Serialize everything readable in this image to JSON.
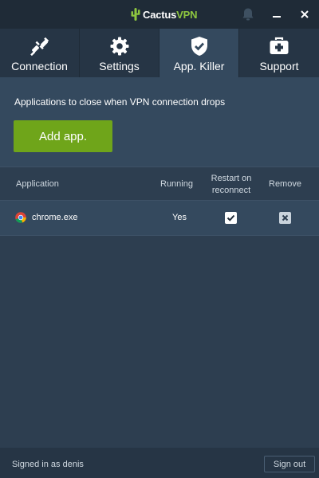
{
  "window": {
    "logo_part1": "Cactus",
    "logo_part2": "VPN",
    "controls": {
      "bell_icon": "bell-icon",
      "minimize_icon": "minimize-icon",
      "close_icon": "close-icon"
    }
  },
  "tabs": [
    {
      "label": "Connection",
      "icon": "plug-icon",
      "active": false
    },
    {
      "label": "Settings",
      "icon": "gear-icon",
      "active": false
    },
    {
      "label": "App. Killer",
      "icon": "shield-check-icon",
      "active": true
    },
    {
      "label": "Support",
      "icon": "first-aid-kit-icon",
      "active": false
    }
  ],
  "app_killer": {
    "intro": "Applications to close when VPN connection drops",
    "add_button": "Add app.",
    "columns": {
      "application": "Application",
      "running": "Running",
      "restart": "Restart on reconnect",
      "remove": "Remove"
    },
    "rows": [
      {
        "name": "chrome.exe",
        "icon": "chrome-icon",
        "running": "Yes",
        "restart": true
      }
    ]
  },
  "footer": {
    "signed_in": "Signed in as denis",
    "sign_out": "Sign out"
  },
  "colors": {
    "accent": "#6fa51a",
    "brand_green": "#8dc63f",
    "background": "#2d3e50",
    "titlebar": "#1f2b37"
  }
}
